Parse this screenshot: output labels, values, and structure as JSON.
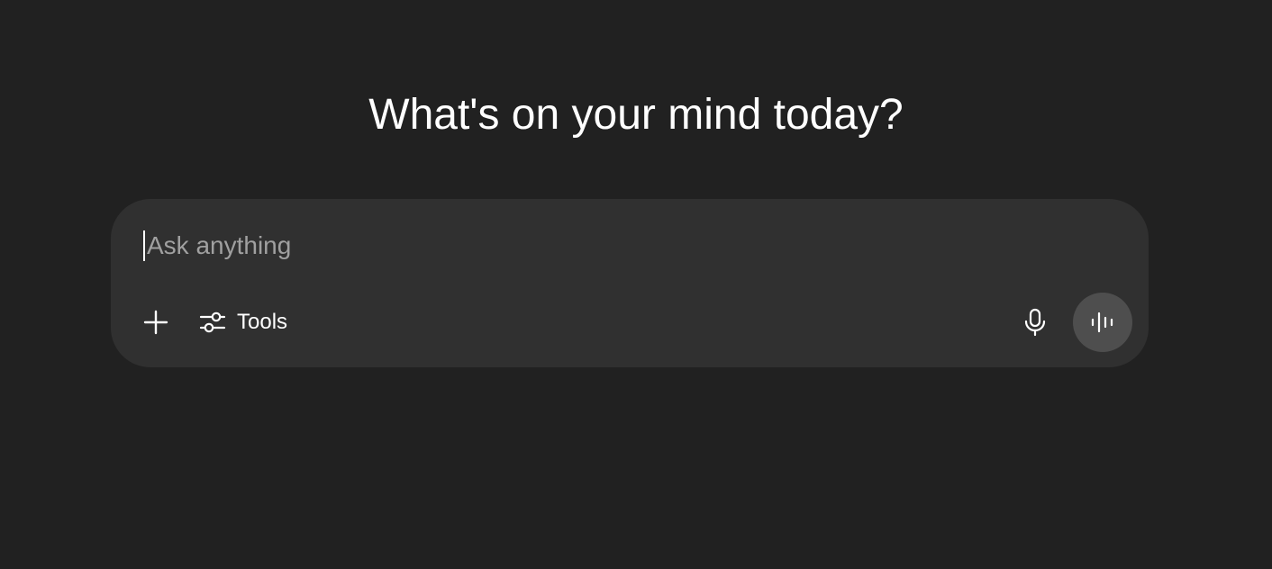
{
  "hero": {
    "title": "What's on your mind today?"
  },
  "composer": {
    "placeholder": "Ask anything",
    "value": ""
  },
  "toolbar": {
    "add_icon": "plus-icon",
    "tools_icon": "sliders-icon",
    "tools_label": "Tools",
    "dictate_icon": "microphone-icon",
    "voice_icon": "voice-waveform-icon"
  },
  "colors": {
    "background": "#212121",
    "composer": "#303030",
    "voice_button": "#4e4e4e",
    "text": "#ffffff",
    "placeholder": "#a0a0a0"
  }
}
